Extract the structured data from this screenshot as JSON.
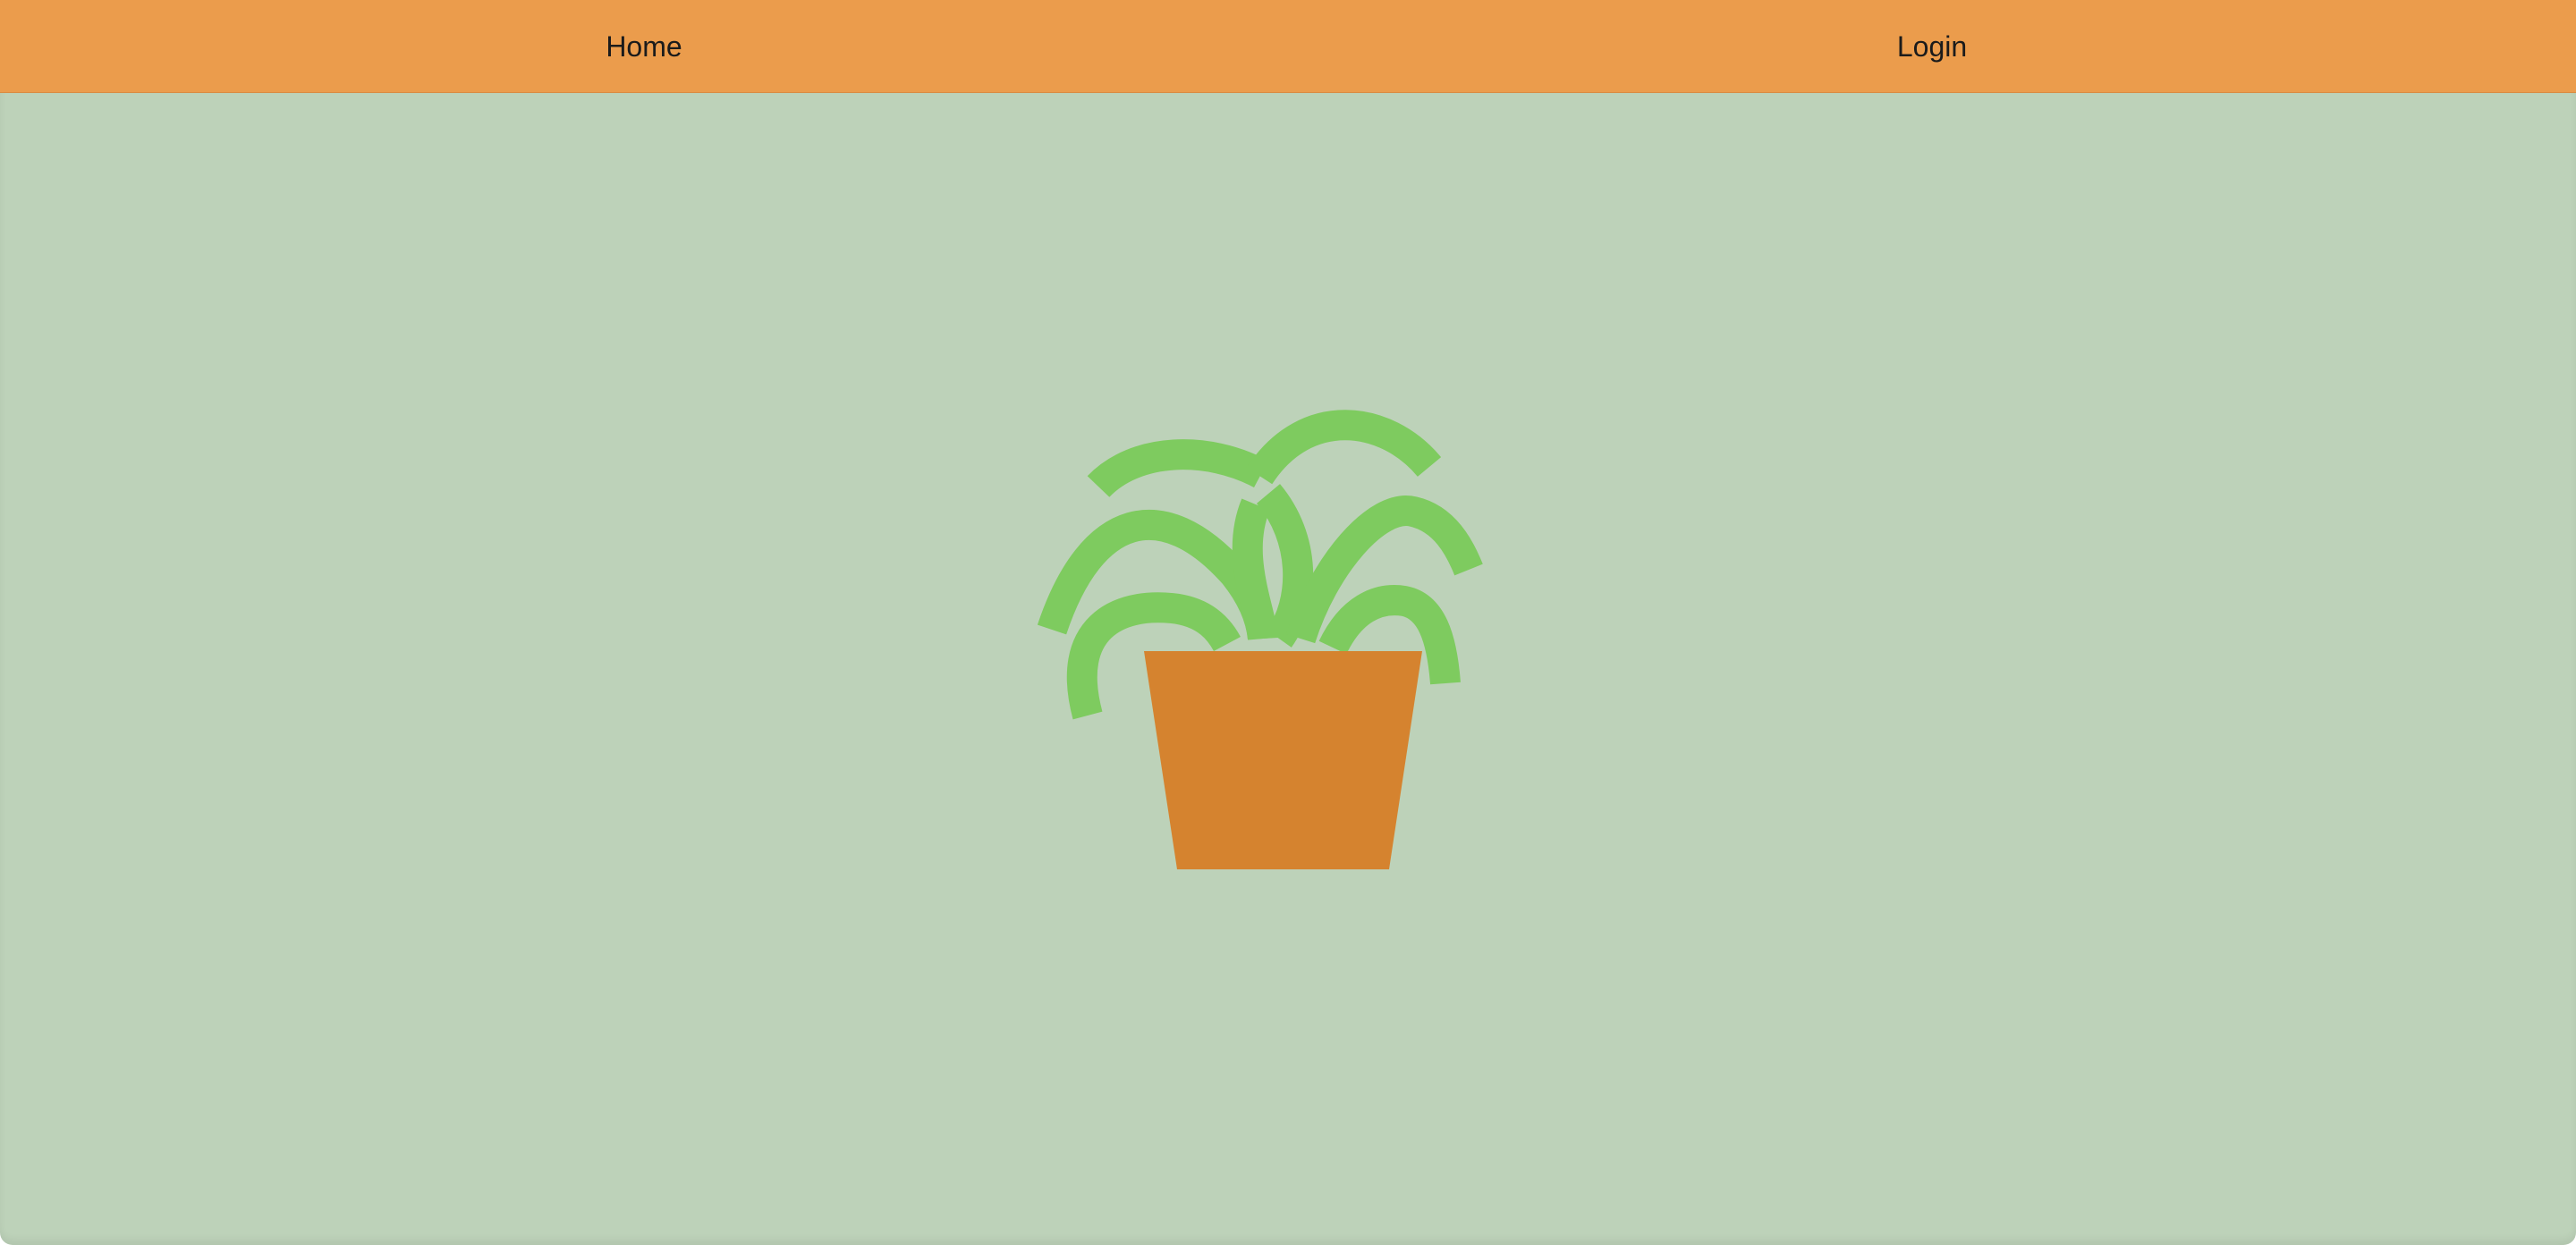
{
  "nav": {
    "home_label": "Home",
    "login_label": "Login"
  },
  "hero": {
    "image": "potted-plant-illustration"
  },
  "colors": {
    "navbar_background": "#eb9c4c",
    "page_background": "#bdd2b9",
    "leaf_green": "#7ecb5f",
    "pot_orange": "#d5832f",
    "nav_text": "#1b1b1b"
  }
}
